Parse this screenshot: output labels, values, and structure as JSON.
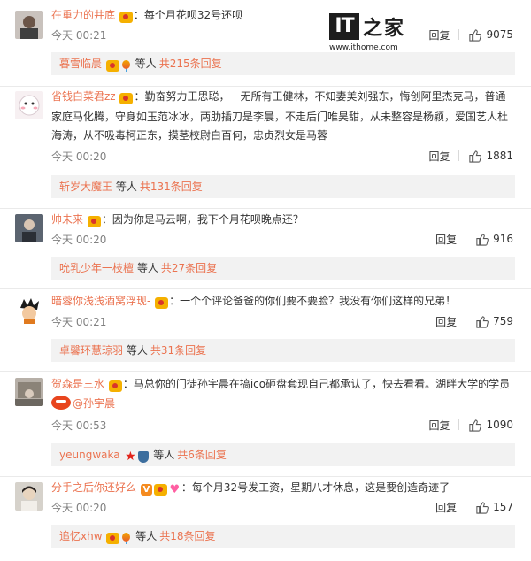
{
  "watermark": {
    "logo_it": "IT",
    "logo_zh": "之家",
    "url": "www.ithome.com"
  },
  "comments": [
    {
      "username": "在重力的井底",
      "text": "：每个月花呗32号还呗",
      "time": "今天 00:21",
      "reply_label": "回复",
      "likes": "9075",
      "replies": {
        "username": "暮雪临晨",
        "others": "等人",
        "summary": "共215条回复"
      }
    },
    {
      "username": "省钱白菜君zz",
      "text": "：勤奋努力王思聪，一无所有王健林，不知妻美刘强东，悔创阿里杰克马，普通家庭马化腾，守身如玉范冰冰，两肋插刀是李晨，不走后门唯昊甜，从未整容是杨颖，爱国艺人杜海涛，从不吸毒柯正东，摸茎校尉白百何，忠贞烈女是马蓉",
      "time": "今天 00:20",
      "reply_label": "回复",
      "likes": "1881",
      "replies": {
        "username": "斩岁大魔王",
        "others": "等人",
        "summary": "共131条回复"
      }
    },
    {
      "username": "帅未来",
      "text": "：因为你是马云啊，我下个月花呗晚点还？",
      "time": "今天 00:20",
      "reply_label": "回复",
      "likes": "916",
      "replies": {
        "username": "吮乳少年一枝檀",
        "others": "等人",
        "summary": "共27条回复"
      }
    },
    {
      "username": "暗蓉你浅浅酒窝浮现-",
      "text": "：一个个评论爸爸的你们要不要脸？我没有你们这样的兄弟！",
      "time": "今天 00:21",
      "reply_label": "回复",
      "likes": "759",
      "replies": {
        "username": "卓馨环慧琼羽",
        "others": "等人",
        "summary": "共31条回复"
      }
    },
    {
      "username": "贺森是三水",
      "text": "：马总你的门徒孙宇晨在搞ico砸盘套现自己都承认了，快去看看。湖畔大学的学员",
      "mention": "@孙宇晨",
      "time": "今天 00:53",
      "reply_label": "回复",
      "likes": "1090",
      "replies": {
        "username": "yeungwaka",
        "others": "等人",
        "summary": "共6条回复"
      }
    },
    {
      "username": "分手之后你还好么",
      "text": "：每个月32号发工资，星期八才休息，这是要创造奇迹了",
      "time": "今天 00:20",
      "reply_label": "回复",
      "likes": "157",
      "replies": {
        "username": "追忆xhw",
        "others": "等人",
        "summary": "共18条回复"
      }
    }
  ],
  "icons": {
    "like": "thumbs-up-icon",
    "badges": "user-badge-icons"
  },
  "colors": {
    "username": "#eb7350",
    "reply_bg": "#f2f2f2",
    "time": "#808080",
    "text": "#333333"
  }
}
